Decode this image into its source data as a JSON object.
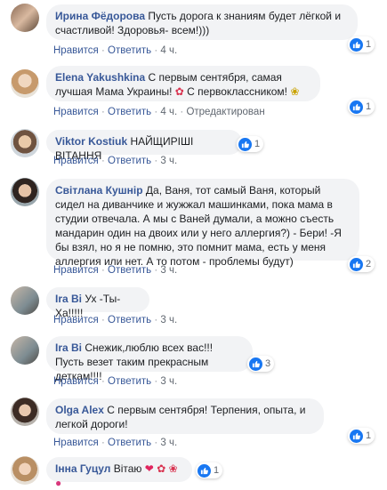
{
  "labels": {
    "like": "Нравится",
    "reply": "Ответить",
    "dot": "·",
    "edited": "Отредактирован"
  },
  "comments": [
    {
      "author": "Ирина Фёдорова",
      "text": "Пусть дорога к знаниям будет лёгкой и счастливой! Здоровья- всем!)))",
      "time": "4 ч.",
      "reactions": "1"
    },
    {
      "author": "Elena Yakushkina",
      "text": "С первым сентября, самая лучшая Мама Украины!",
      "text2": "С первоклассником!",
      "time": "4 ч.",
      "reactions": "1"
    },
    {
      "author": "Viktor Kostiuk",
      "text": "НАЙЩИРІШІ ВІТАННЯ",
      "time": "3 ч.",
      "reactions": "1"
    },
    {
      "author": "Світлана Кушнір",
      "text": "Да, Ваня, тот самый Ваня, который сидел на диванчике и жужжал машинками, пока мама в студии отвечала. А мы с Ваней думали, а можно съесть мандарин один на двоих или у него аллергия?) - Бери! -Я бы взял, но я не помню, это помнит мама, есть у меня аллергия или нет. А то потом - проблемы будут)",
      "time": "3 ч.",
      "reactions": "2"
    },
    {
      "author": "Ira Bi",
      "text": "Ух -Ты-Ха!!!!!",
      "time": "3 ч.",
      "reactions": ""
    },
    {
      "author": "Ira Bi",
      "text": "Снежик,люблю всех вас!!!",
      "text2": "Пусть везет таким прекрасным деткам!!!!",
      "time": "3 ч.",
      "reactions": "3"
    },
    {
      "author": "Olga Alex",
      "text": "С первым сентября! Терпения, опыта, и легкой дороги!",
      "time": "3 ч.",
      "reactions": "1"
    },
    {
      "author": "Інна Гуцул",
      "text": "Вітаю",
      "time": "",
      "reactions": "1"
    }
  ],
  "colors": {
    "link": "#385898",
    "bubble": "#f2f3f5",
    "like": "#1877f2",
    "meta": "#606770"
  }
}
